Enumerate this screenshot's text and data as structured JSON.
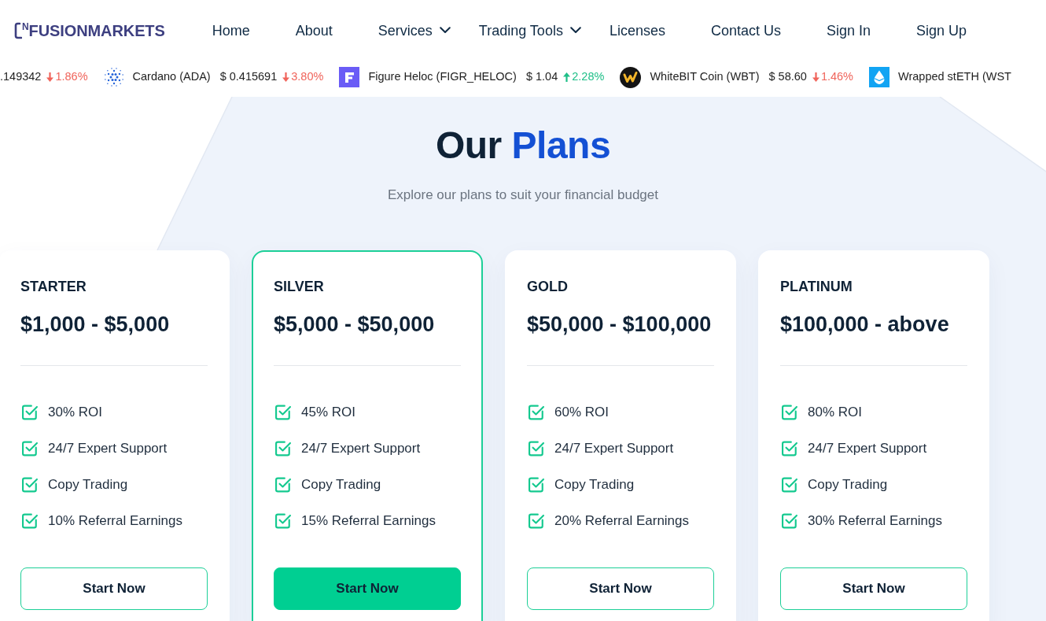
{
  "header": {
    "logo": "NFUSIONMARKETS",
    "nav": [
      {
        "label": "Home",
        "dropdown": false
      },
      {
        "label": "About",
        "dropdown": false
      },
      {
        "label": "Services",
        "dropdown": true
      },
      {
        "label": "Trading Tools",
        "dropdown": true
      },
      {
        "label": "Licenses",
        "dropdown": false
      },
      {
        "label": "Contact Us",
        "dropdown": false
      },
      {
        "label": "Sign In",
        "dropdown": false
      },
      {
        "label": "Sign Up",
        "dropdown": false
      }
    ]
  },
  "ticker": [
    {
      "price": ".149342",
      "change": "1.86%",
      "rising": false
    },
    {
      "name": "Cardano (ADA)",
      "price": "$ 0.415691",
      "change": "3.80%",
      "rising": false
    },
    {
      "name": "Figure Heloc (FIGR_HELOC)",
      "price": "$ 1.04",
      "change": "2.28%",
      "rising": true
    },
    {
      "name": "WhiteBIT Coin (WBT)",
      "price": "$ 58.60",
      "change": "1.46%",
      "rising": false
    },
    {
      "name": "Wrapped stETH (WST"
    }
  ],
  "plans_section": {
    "title": "Our",
    "title_highlight": "Plans",
    "subtitle": "Explore our plans to suit your financial budget"
  },
  "plans": [
    {
      "name": "STARTER",
      "range": "$1,000 - $5,000",
      "featured": false,
      "features": [
        "30% ROI",
        "24/7 Expert Support",
        "Copy Trading",
        "10% Referral Earnings"
      ],
      "button": "Start Now"
    },
    {
      "name": "SILVER",
      "range": "$5,000 - $50,000",
      "featured": true,
      "features": [
        "45% ROI",
        "24/7 Expert Support",
        "Copy Trading",
        "15% Referral Earnings"
      ],
      "button": "Start Now"
    },
    {
      "name": "GOLD",
      "range": "$50,000 - $100,000",
      "featured": false,
      "features": [
        "60% ROI",
        "24/7 Expert Support",
        "Copy Trading",
        "20% Referral Earnings"
      ],
      "button": "Start Now"
    },
    {
      "name": "PLATINUM",
      "range": "$100,000 - above",
      "featured": false,
      "features": [
        "80% ROI",
        "24/7 Expert Support",
        "Copy Trading",
        "30% Referral Earnings"
      ],
      "button": "Start Now"
    }
  ]
}
